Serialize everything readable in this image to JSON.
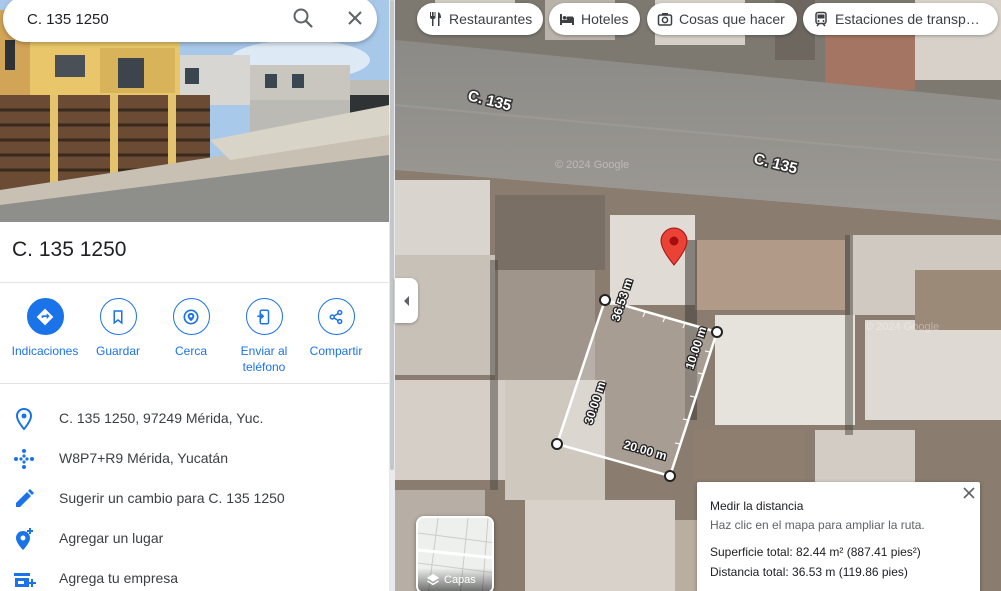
{
  "search": {
    "value": "C. 135 1250"
  },
  "place": {
    "title": "C. 135 1250"
  },
  "actions": [
    {
      "label": "Indicaciones"
    },
    {
      "label": "Guardar"
    },
    {
      "label": "Cerca"
    },
    {
      "label": "Enviar al teléfono"
    },
    {
      "label": "Compartir"
    }
  ],
  "info": [
    {
      "text": "C. 135 1250, 97249 Mérida, Yuc.",
      "icon": "location-pin-icon"
    },
    {
      "text": "W8P7+R9 Mérida, Yucatán",
      "icon": "plus-code-icon"
    },
    {
      "text": "Sugerir un cambio para C. 135 1250",
      "icon": "pencil-icon"
    },
    {
      "text": "Agregar un lugar",
      "icon": "add-place-icon"
    },
    {
      "text": "Agrega tu empresa",
      "icon": "add-business-icon"
    }
  ],
  "map": {
    "chips": [
      {
        "label": "Restaurantes",
        "icon": "fork-knife-icon"
      },
      {
        "label": "Hoteles",
        "icon": "bed-icon"
      },
      {
        "label": "Cosas que hacer",
        "icon": "camera-icon"
      },
      {
        "label": "Estaciones de transp…",
        "icon": "transit-icon"
      }
    ],
    "street_labels": [
      "C. 135",
      "C. 135"
    ],
    "watermarks": [
      "© 2024 Google",
      "© 2024 Google"
    ],
    "measure_labels": [
      "36.53 m",
      "10.00 m",
      "30.00 m",
      "20.00 m"
    ],
    "layers_label": "Capas"
  },
  "measure": {
    "title": "Medir la distancia",
    "hint": "Haz clic en el mapa para ampliar la ruta.",
    "area": "Superficie total: 82.44 m² (887.41 pies²)",
    "distance": "Distancia total: 36.53 m (119.86 pies)"
  },
  "colors": {
    "accent": "#1a73e8",
    "pin": "#ea4335"
  }
}
